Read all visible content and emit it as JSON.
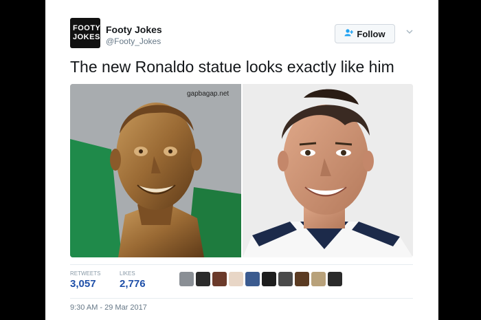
{
  "account": {
    "avatar_line1": "FOOTY",
    "avatar_line2": "JOKES",
    "display_name": "Footy Jokes",
    "handle": "@Footy_Jokes"
  },
  "follow_button": {
    "label": "Follow",
    "icon": "add-user-icon"
  },
  "menu": {
    "icon": "chevron-down-icon"
  },
  "tweet": {
    "text": "The new Ronaldo statue looks exactly like him",
    "media": {
      "watermark": "gapbagap.net",
      "left_image": "bronze-statue-bust",
      "right_image": "footballer-portrait"
    }
  },
  "stats": {
    "retweets_label": "RETWEETS",
    "retweets_count": "3,057",
    "likes_label": "LIKES",
    "likes_count": "2,776",
    "liker_avatar_count": 10
  },
  "timestamp": "9:30 AM - 29 Mar 2017",
  "colors": {
    "background": "#000000",
    "card": "#ffffff",
    "accent_blue": "#1da1f2",
    "stat_value": "#1d4ea8"
  }
}
